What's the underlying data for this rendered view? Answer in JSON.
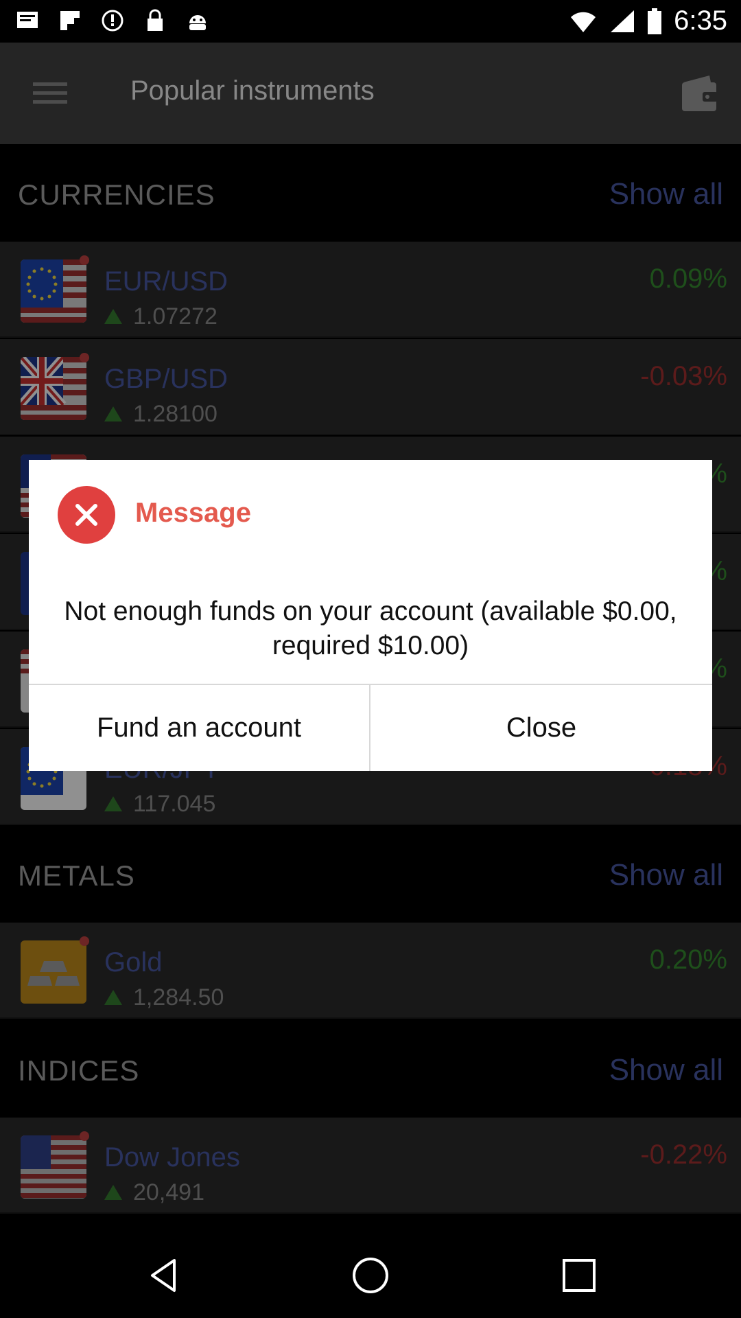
{
  "status_bar": {
    "time": "6:35",
    "icons": [
      "notification-icon",
      "flipboard-icon",
      "alarm-icon",
      "lock-icon",
      "android-icon"
    ]
  },
  "app_bar": {
    "title": "Popular instruments"
  },
  "sections": {
    "currencies": {
      "title": "CURRENCIES",
      "show_all": "Show all"
    },
    "metals": {
      "title": "METALS",
      "show_all": "Show all"
    },
    "indices": {
      "title": "INDICES",
      "show_all": "Show all"
    }
  },
  "rows": {
    "eurusd": {
      "name": "EUR/USD",
      "price": "1.07272",
      "change": "0.09%",
      "flag": "eu-flag-icon"
    },
    "gbpusd": {
      "name": "GBP/USD",
      "price": "1.28100",
      "change": "-0.03%",
      "flag": "uk-flag-icon"
    },
    "row3": {
      "change": "%"
    },
    "row4": {
      "change": "%"
    },
    "row5": {
      "change": "%"
    },
    "eurjpy": {
      "name": "EUR/JPY",
      "price": "117.045",
      "change": "0.18%",
      "flag": "eu-flag-icon"
    },
    "gold": {
      "name": "Gold",
      "price": "1,284.50",
      "change": "0.20%",
      "flag": "gold-bars-icon"
    },
    "dowjones": {
      "name": "Dow Jones",
      "price": "20,491",
      "change": "-0.22%",
      "flag": "us-flag-icon"
    }
  },
  "dialog": {
    "title": "Message",
    "message": "Not enough funds on your account  (available $0.00, required  $10.00)",
    "fund_label": "Fund an account",
    "close_label": "Close"
  },
  "colors": {
    "accent_blue": "#3f4d8f",
    "positive": "#2f7a2a",
    "negative": "#8e2a2a",
    "dialog_red": "#e0403f"
  }
}
